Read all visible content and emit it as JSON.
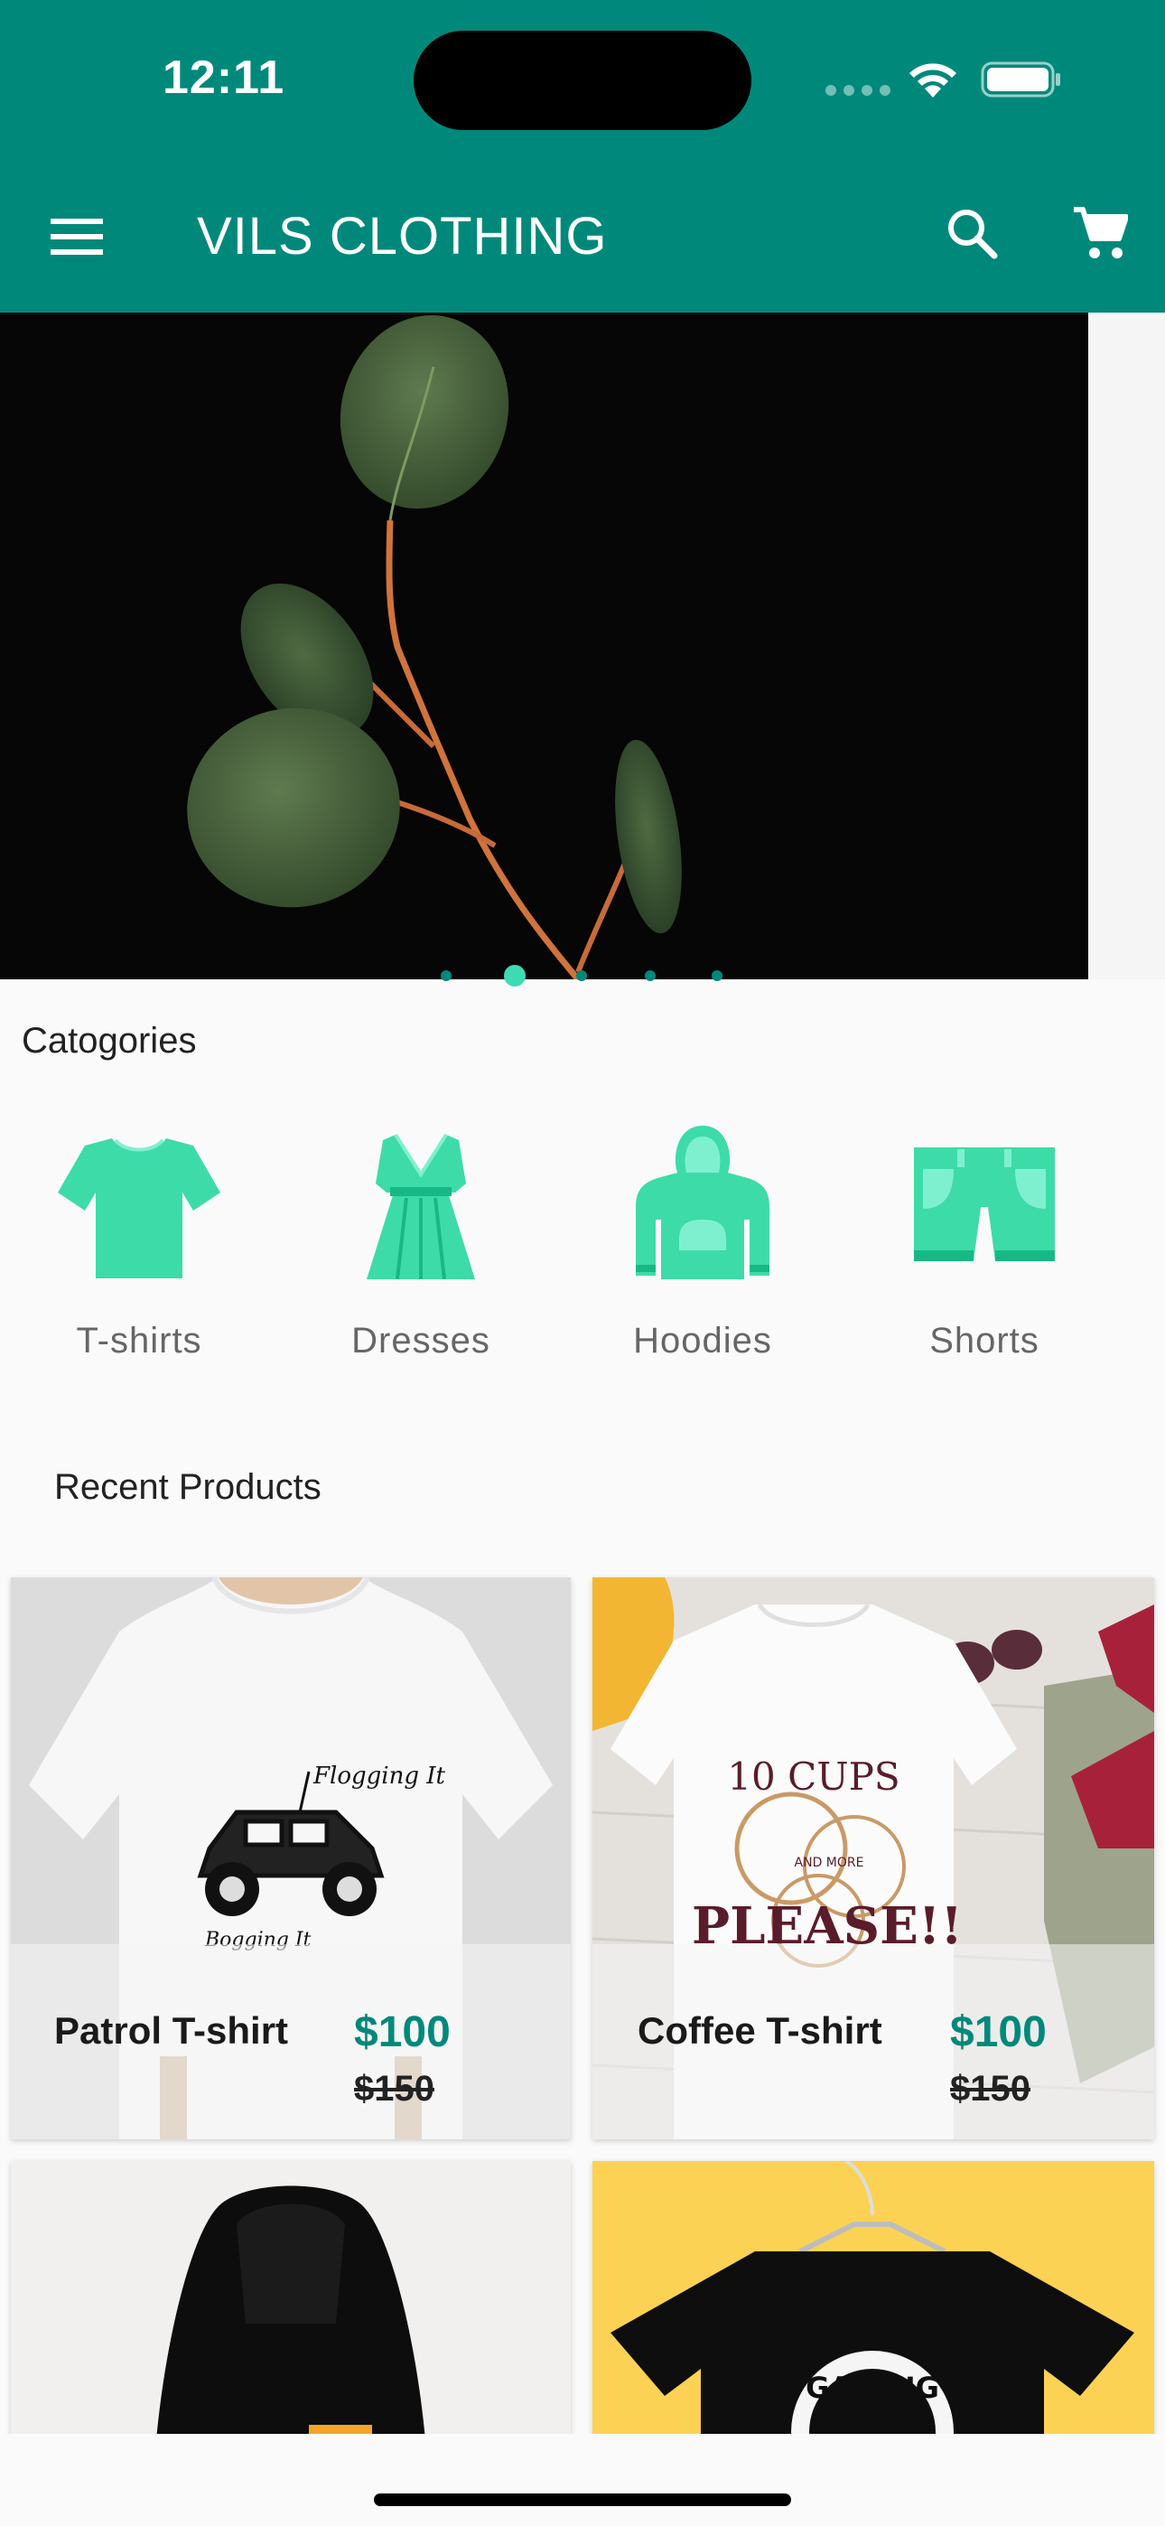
{
  "status_bar": {
    "time": "12:11"
  },
  "app_bar": {
    "title": "VILS CLOTHING",
    "icons": [
      "menu-icon",
      "search-icon",
      "cart-icon"
    ]
  },
  "banner": {
    "slides": 5,
    "active_slide": 2
  },
  "categories": {
    "title": "Catogories",
    "items": [
      {
        "label": "T-shirts",
        "icon": "tshirt-icon"
      },
      {
        "label": "Dresses",
        "icon": "dress-icon"
      },
      {
        "label": "Hoodies",
        "icon": "hoodie-icon"
      },
      {
        "label": "Shorts",
        "icon": "shorts-icon"
      }
    ]
  },
  "recent": {
    "title": "Recent Products",
    "products": [
      {
        "name": "Patrol T-shirt",
        "price": "$100",
        "old_price": "$150"
      },
      {
        "name": "Coffee T-shirt",
        "price": "$100",
        "old_price": "$150"
      },
      {
        "name": "",
        "price": "",
        "old_price": ""
      },
      {
        "name": "",
        "price": "",
        "old_price": ""
      }
    ]
  },
  "shirt_prints": {
    "patrol": {
      "top": "Flogging It",
      "bottom": "Bogging It"
    },
    "coffee": {
      "line1": "10 CUPS",
      "line2": "AND MORE",
      "line3": "PLEASE!!"
    },
    "gaming": {
      "text": "GAMING"
    }
  },
  "colors": {
    "primary": "#00897b",
    "category_icon": "#3ddba8",
    "category_icon_light": "#7ff0cf"
  }
}
